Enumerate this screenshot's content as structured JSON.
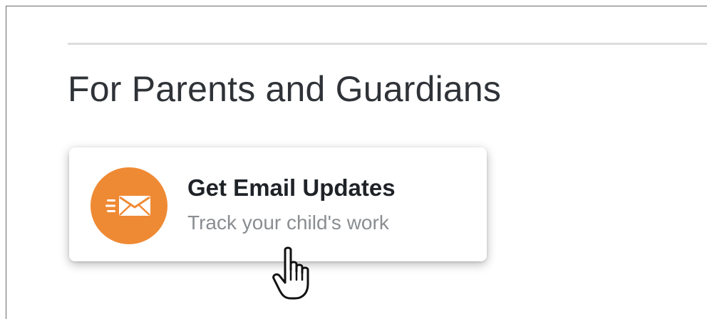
{
  "section": {
    "title": "For Parents and Guardians"
  },
  "email_card": {
    "title": "Get Email Updates",
    "subtitle": "Track your child's work",
    "icon": "email-fast-icon",
    "accent_color": "#ef8a34"
  },
  "pointer": {
    "icon": "hand-pointer-icon"
  }
}
